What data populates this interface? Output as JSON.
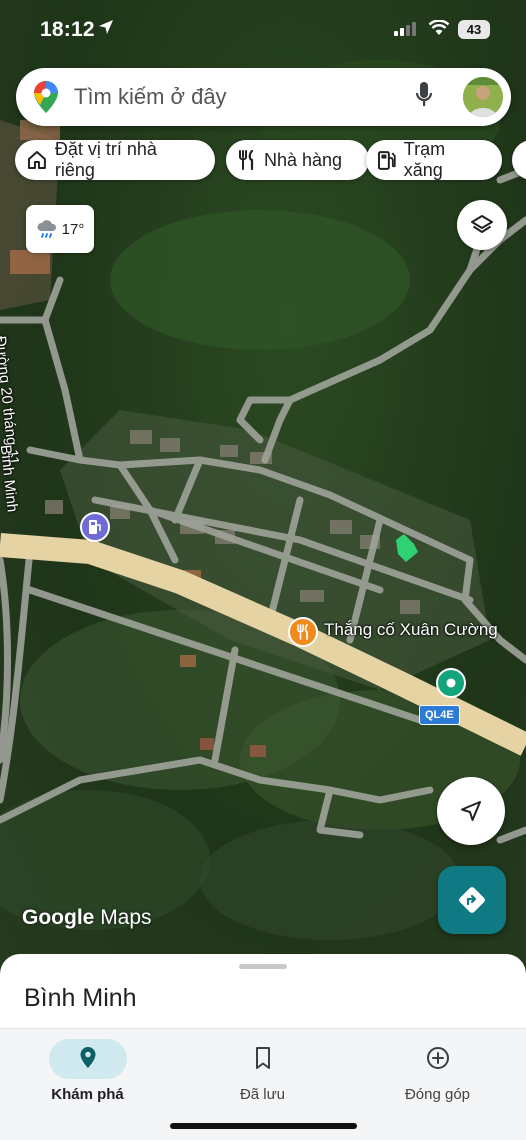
{
  "status_bar": {
    "time": "18:12",
    "battery": "43"
  },
  "search": {
    "placeholder": "Tìm kiếm ở đây"
  },
  "chips": [
    {
      "label": "Đặt vị trí nhà riêng",
      "icon": "home-icon"
    },
    {
      "label": "Nhà hàng",
      "icon": "restaurant-icon"
    },
    {
      "label": "Trạm xăng",
      "icon": "gas-station-icon"
    }
  ],
  "weather": {
    "temp": "17°",
    "icon": "cloud-rain-icon"
  },
  "map": {
    "street_labels": [
      "Đường 20 tháng 11",
      "Bình Minh"
    ],
    "poi": {
      "name": "Thắng cố Xuân Cường",
      "icon": "restaurant-icon"
    },
    "road_shield": "QL4E",
    "attribution_google": "Google",
    "attribution_maps": "Maps"
  },
  "bottom_sheet": {
    "title": "Bình Minh"
  },
  "nav": [
    {
      "label": "Khám phá",
      "icon": "explore-pin-icon",
      "active": true
    },
    {
      "label": "Đã lưu",
      "icon": "bookmark-icon",
      "active": false
    },
    {
      "label": "Đóng góp",
      "icon": "add-circle-icon",
      "active": false
    }
  ],
  "colors": {
    "accent": "#0f7a84",
    "nav_pill": "#cfe9ee",
    "poi_orange": "#f08a1c",
    "poi_green": "#13a47c",
    "gas_purple": "#6e6bd6",
    "road": "#e6d3a3"
  }
}
